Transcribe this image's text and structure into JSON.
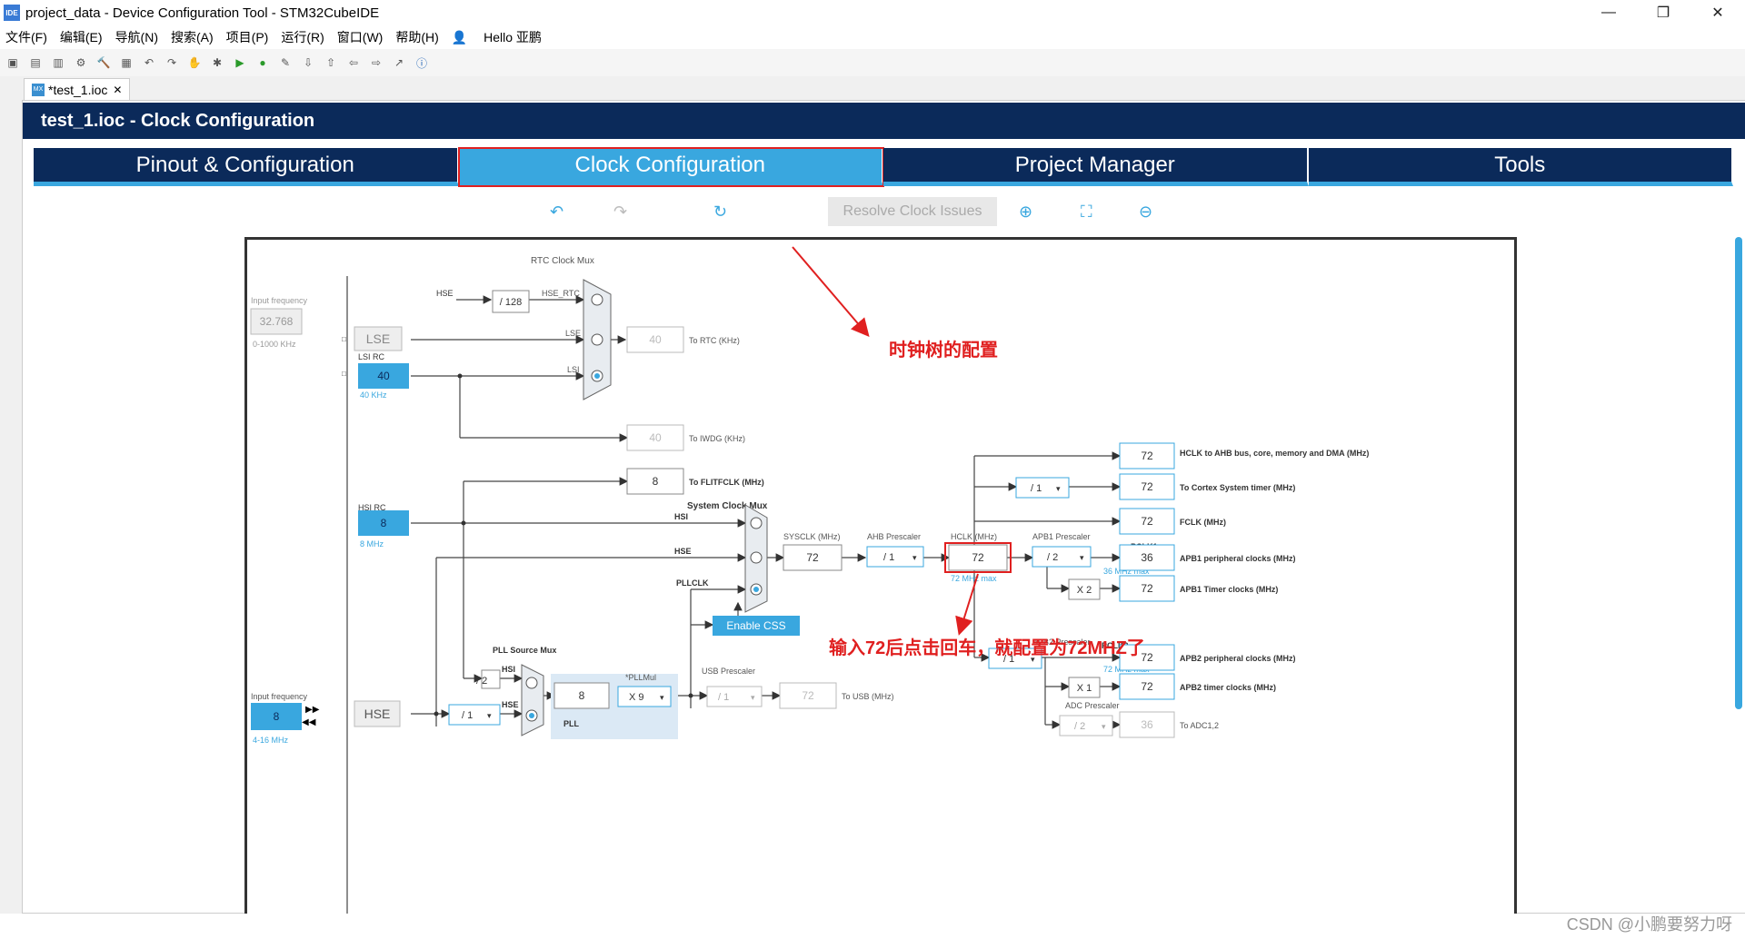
{
  "window": {
    "title": "project_data - Device Configuration Tool - STM32CubeIDE",
    "icon_text": "IDE"
  },
  "menu": [
    "文件(F)",
    "编辑(E)",
    "导航(N)",
    "搜索(A)",
    "项目(P)",
    "运行(R)",
    "窗口(W)",
    "帮助(H)",
    "Hello 亚鹏"
  ],
  "editor_tab": {
    "label": "*test_1.ioc",
    "icon_text": "MX"
  },
  "header": {
    "title": "test_1.ioc - Clock Configuration"
  },
  "tabs": [
    "Pinout & Configuration",
    "Clock Configuration",
    "Project Manager",
    "Tools"
  ],
  "resolve_label": "Resolve Clock Issues",
  "clock": {
    "rtc_mux": "RTC Clock Mux",
    "input_freq": "Input frequency",
    "lse_value": "32.768",
    "lse_range": "0-1000 KHz",
    "lse_label": "LSE",
    "lsi_rc": "LSI RC",
    "lsi_value": "40",
    "lsi_freq": "40 KHz",
    "hse_div128": "/ 128",
    "hse": "HSE",
    "hse_rtc": "HSE_RTC",
    "lse": "LSE",
    "lsi": "LSI",
    "to_rtc_value": "40",
    "to_rtc": "To RTC (KHz)",
    "to_iwdg_value": "40",
    "to_iwdg": "To IWDG (KHz)",
    "flitf_value": "8",
    "to_flitf": "To FLITFCLK (MHz)",
    "sys_mux": "System Clock Mux",
    "hsi_rc": "HSI RC",
    "hsi_value": "8",
    "hsi_freq": "8 MHz",
    "hsi": "HSI",
    "pllclk": "PLLCLK",
    "sysclk_label": "SYSCLK (MHz)",
    "sysclk": "72",
    "ahb_label": "AHB Prescaler",
    "ahb": "/ 1",
    "hclk_label": "HCLK (MHz)",
    "hclk": "72",
    "hclk_max": "72 MHz max",
    "apb1_label": "APB1 Prescaler",
    "apb1": "/ 2",
    "pclk1": "PCLK1",
    "pclk1_max": "36 MHz max",
    "x2": "X 2",
    "apb2_label": "APB2 Prescaler",
    "apb2": "/ 1",
    "pclk2": "PCLK2",
    "pclk2_max": "72 MHz max",
    "x1": "X 1",
    "adc_label": "ADC Prescaler",
    "adc": "/ 2",
    "adc_value": "36",
    "to_adc": "To ADC1,2",
    "cortex_div": "/ 1",
    "out_ahb_value": "72",
    "out_ahb": "HCLK to AHB bus, core, memory and DMA (MHz)",
    "out_cortex_value": "72",
    "out_cortex": "To Cortex System timer (MHz)",
    "out_fclk_value": "72",
    "out_fclk": "FCLK (MHz)",
    "out_apb1p_value": "36",
    "out_apb1p": "APB1 peripheral clocks (MHz)",
    "out_apb1t_value": "72",
    "out_apb1t": "APB1 Timer clocks (MHz)",
    "out_apb2p_value": "72",
    "out_apb2p": "APB2 peripheral clocks (MHz)",
    "out_apb2t_value": "72",
    "out_apb2t": "APB2 timer clocks (MHz)",
    "enable_css": "Enable CSS",
    "pll_src_mux": "PLL Source Mux",
    "hsi_div2": "/ 2",
    "hse_input_freq": "Input frequency",
    "hse_value": "8",
    "hse_range": "4-16 MHz",
    "hse_label": "HSE",
    "hse_div": "/ 1",
    "pll_in": "8",
    "pllmul_label": "*PLLMul",
    "pllmul": "X 9",
    "pll": "PLL",
    "usb_label": "USB Prescaler",
    "usb": "/ 1",
    "usb_value": "72",
    "to_usb": "To USB (MHz)"
  },
  "annotations": {
    "a1": "时钟树的配置",
    "a2": "输入72后点击回车，就配置为72MHZ了"
  },
  "watermark": "CSDN @小鹏要努力呀"
}
